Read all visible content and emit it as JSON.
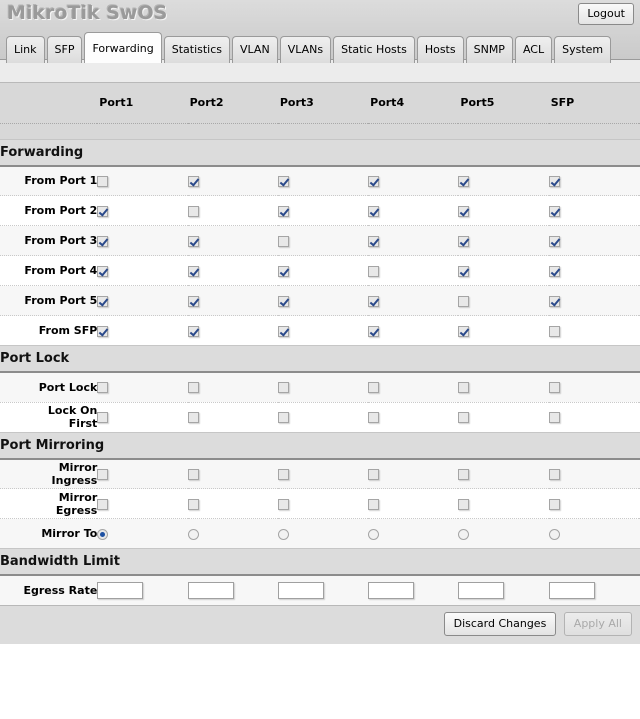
{
  "header": {
    "title": "MikroTik SwOS",
    "logout_label": "Logout"
  },
  "tabs": [
    {
      "label": "Link",
      "active": false
    },
    {
      "label": "SFP",
      "active": false
    },
    {
      "label": "Forwarding",
      "active": true
    },
    {
      "label": "Statistics",
      "active": false
    },
    {
      "label": "VLAN",
      "active": false
    },
    {
      "label": "VLANs",
      "active": false
    },
    {
      "label": "Static Hosts",
      "active": false
    },
    {
      "label": "Hosts",
      "active": false
    },
    {
      "label": "SNMP",
      "active": false
    },
    {
      "label": "ACL",
      "active": false
    },
    {
      "label": "System",
      "active": false
    }
  ],
  "columns": [
    "Port1",
    "Port2",
    "Port3",
    "Port4",
    "Port5",
    "SFP"
  ],
  "sections": [
    {
      "title": "Forwarding",
      "rows": [
        {
          "label": "From Port 1",
          "type": "checkbox",
          "values": [
            false,
            true,
            true,
            true,
            true,
            true
          ]
        },
        {
          "label": "From Port 2",
          "type": "checkbox",
          "values": [
            true,
            false,
            true,
            true,
            true,
            true
          ]
        },
        {
          "label": "From Port 3",
          "type": "checkbox",
          "values": [
            true,
            true,
            false,
            true,
            true,
            true
          ]
        },
        {
          "label": "From Port 4",
          "type": "checkbox",
          "values": [
            true,
            true,
            true,
            false,
            true,
            true
          ]
        },
        {
          "label": "From Port 5",
          "type": "checkbox",
          "values": [
            true,
            true,
            true,
            true,
            false,
            true
          ]
        },
        {
          "label": "From SFP",
          "type": "checkbox",
          "values": [
            true,
            true,
            true,
            true,
            true,
            false
          ]
        }
      ]
    },
    {
      "title": "Port Lock",
      "rows": [
        {
          "label": "Port Lock",
          "type": "checkbox",
          "values": [
            false,
            false,
            false,
            false,
            false,
            false
          ]
        },
        {
          "label": "Lock On\nFirst",
          "type": "checkbox",
          "values": [
            false,
            false,
            false,
            false,
            false,
            false
          ]
        }
      ]
    },
    {
      "title": "Port Mirroring",
      "rows": [
        {
          "label": "Mirror\nIngress",
          "type": "checkbox",
          "values": [
            false,
            false,
            false,
            false,
            false,
            false
          ]
        },
        {
          "label": "Mirror\nEgress",
          "type": "checkbox",
          "values": [
            false,
            false,
            false,
            false,
            false,
            false
          ]
        },
        {
          "label": "Mirror To",
          "type": "radio",
          "values": [
            true,
            false,
            false,
            false,
            false,
            false
          ]
        }
      ]
    },
    {
      "title": "Bandwidth Limit",
      "rows": [
        {
          "label": "Egress Rate",
          "type": "text",
          "values": [
            "",
            "",
            "",
            "",
            "",
            ""
          ]
        }
      ]
    }
  ],
  "footer": {
    "discard_label": "Discard Changes",
    "apply_label": "Apply All",
    "apply_disabled": true
  }
}
